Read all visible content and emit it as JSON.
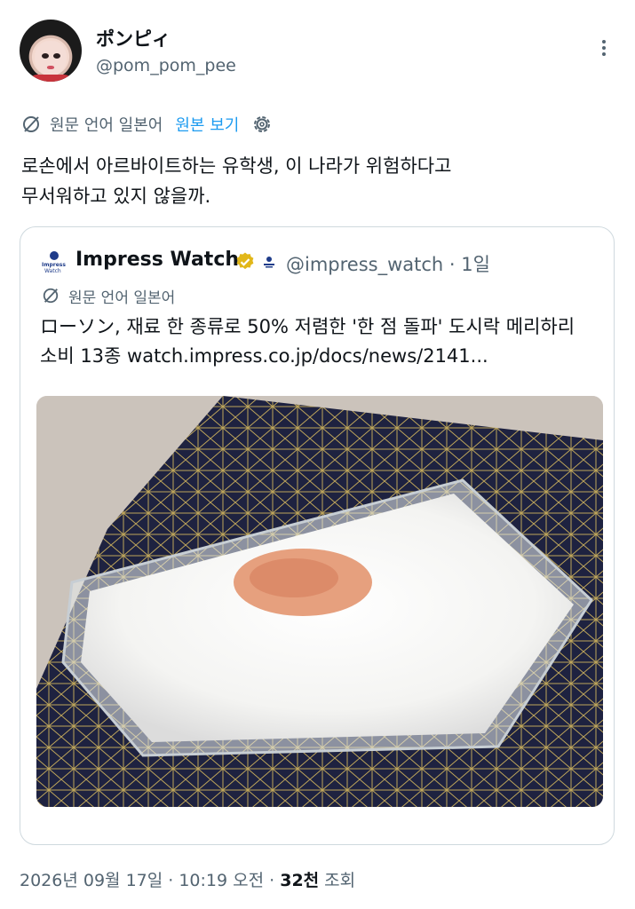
{
  "author": {
    "display_name": "ポンピィ",
    "handle": "@pom_pom_pee"
  },
  "translation_bar": {
    "label": "원문 언어 일본어",
    "show_original": "원본 보기"
  },
  "tweet_text_line1": "로손에서 아르바이트하는 유학생, 이 나라가 위험하다고",
  "tweet_text_line2": "무서워하고 있지 않을까.",
  "quote": {
    "logo_text_top": "Impress",
    "logo_text_bottom": "Watch",
    "display_name": "Impress Watch",
    "handle_time": "@impress_watch · 1일",
    "translation_label": "원문 언어 일본어",
    "text_line1": "ローソン, 재료 한 종류로 50% 저렴한 '한 점 돌파' 도시락 메리하리",
    "text_line2": "소비 13종 watch.impress.co.jp/docs/news/2141..."
  },
  "meta": {
    "date_time": "2026년 09월 17일 · 10:19 오전 · ",
    "views_count": "32천",
    "views_label": " 조회"
  },
  "colors": {
    "accent": "#1d9bf0",
    "secondary_text": "#536471",
    "verified_gold": "#e2b719"
  },
  "icons": [
    "more-icon",
    "translate-icon",
    "settings-icon",
    "verified-icon",
    "affiliate-icon"
  ]
}
